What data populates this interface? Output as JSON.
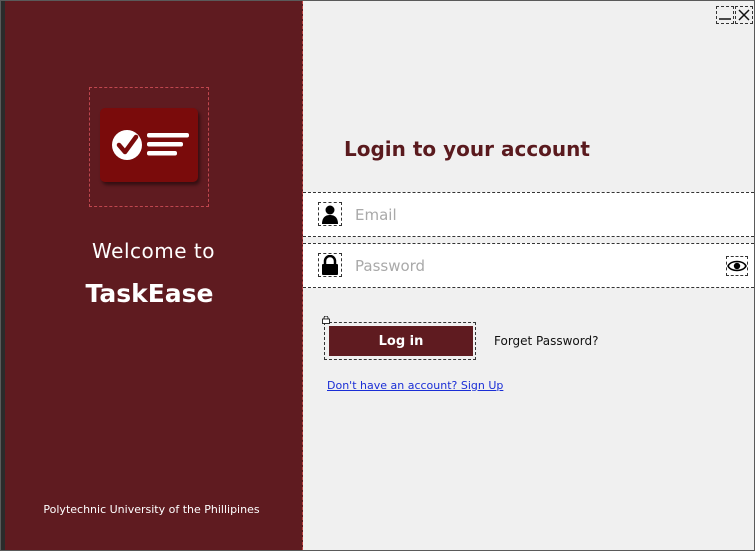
{
  "brand": {
    "welcome_text": "Welcome  to",
    "app_name": "TaskEase",
    "footer_text": "Polytechnic University of the Phillipines",
    "primary_color": "#5f1b20",
    "logo_color": "#7a0b0b",
    "logo_icon": "checklist-icon"
  },
  "window_controls": {
    "minimize_icon": "minimize-icon",
    "close_icon": "close-icon"
  },
  "login": {
    "heading": "Login to your account",
    "email": {
      "placeholder": "Email",
      "value": "",
      "icon": "user-icon"
    },
    "password": {
      "placeholder": "Password",
      "value": "",
      "icon": "lock-icon",
      "toggle_icon": "eye-icon"
    },
    "login_button": "Log in",
    "forgot_link": "Forget Password?",
    "signup_link": "Don't have an account? Sign Up",
    "link_color": "#1a2ed6"
  }
}
